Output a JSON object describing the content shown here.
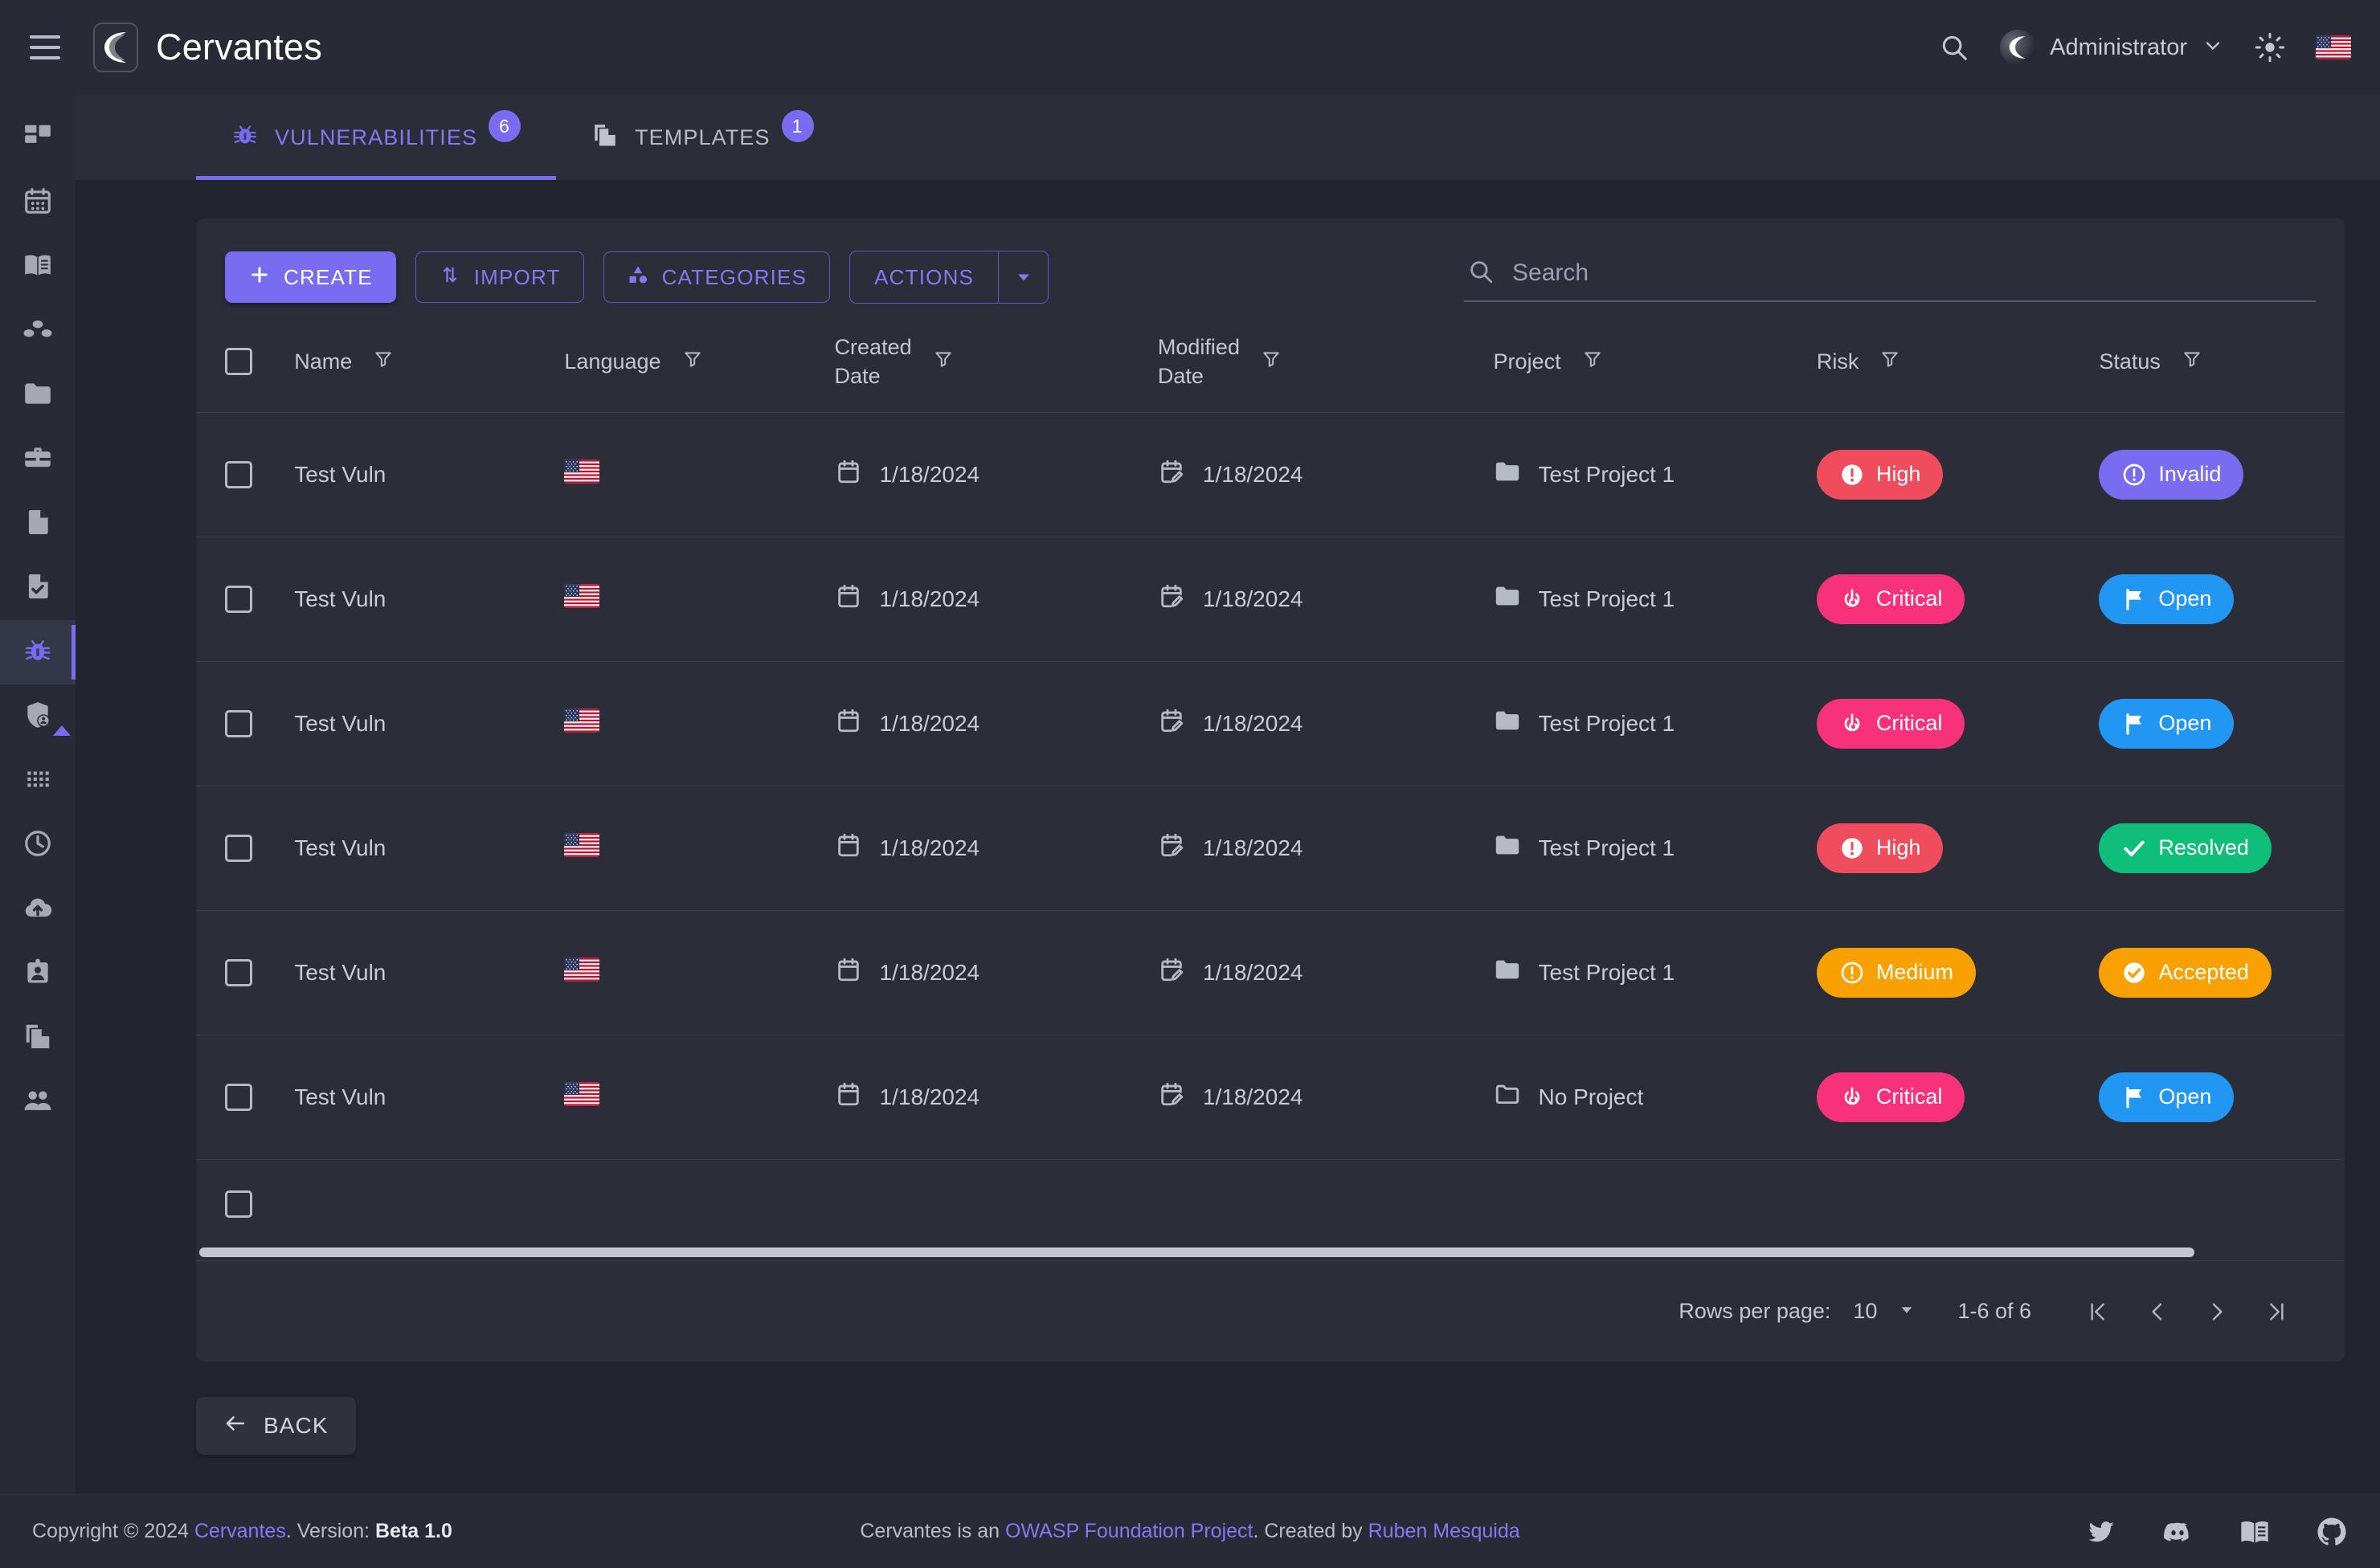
{
  "app": {
    "brand": "Cervantes",
    "menu_icon": "hamburger-icon",
    "logo_icon": "cervantes-logo-icon"
  },
  "header": {
    "search_icon": "search-icon",
    "user_name": "Administrator",
    "user_caret": "chevron-down-icon",
    "theme_icon": "sun-icon",
    "language_flag": "us-flag-icon"
  },
  "sidebar": {
    "items": [
      {
        "name": "dashboard",
        "icon": "dashboard-grid-icon",
        "active": false
      },
      {
        "name": "calendar",
        "icon": "calendar-icon",
        "active": false
      },
      {
        "name": "knowledge-base",
        "icon": "book-icon",
        "active": false
      },
      {
        "name": "organizations",
        "icon": "nodes-icon",
        "active": false
      },
      {
        "name": "projects",
        "icon": "folder-icon",
        "active": false
      },
      {
        "name": "clients",
        "icon": "briefcase-icon",
        "active": false
      },
      {
        "name": "reports",
        "icon": "file-icon",
        "active": false
      },
      {
        "name": "tasks",
        "icon": "file-check-icon",
        "active": false
      },
      {
        "name": "vulnerabilities",
        "icon": "bug-icon",
        "active": true
      },
      {
        "name": "security",
        "icon": "shield-user-icon",
        "active": false
      },
      {
        "name": "apps",
        "icon": "dots-grid-icon",
        "active": false
      },
      {
        "name": "history",
        "icon": "clock-icon",
        "active": false
      },
      {
        "name": "uploads",
        "icon": "cloud-upload-icon",
        "active": false
      },
      {
        "name": "profile",
        "icon": "id-card-icon",
        "active": false
      },
      {
        "name": "templates",
        "icon": "copy-file-icon",
        "active": false
      },
      {
        "name": "users",
        "icon": "users-icon",
        "active": false
      }
    ]
  },
  "tabs": [
    {
      "label": "VULNERABILITIES",
      "badge": "6",
      "icon": "bug-icon",
      "active": true
    },
    {
      "label": "TEMPLATES",
      "badge": "1",
      "icon": "copy-file-icon",
      "active": false
    }
  ],
  "toolbar": {
    "create_label": "CREATE",
    "create_icon": "plus-icon",
    "import_label": "IMPORT",
    "import_icon": "import-arrows-icon",
    "categories_label": "CATEGORIES",
    "categories_icon": "shapes-icon",
    "actions_label": "ACTIONS",
    "actions_caret_icon": "caret-down-icon"
  },
  "search": {
    "placeholder": "Search",
    "value": "",
    "icon": "search-icon"
  },
  "table": {
    "columns": [
      {
        "key": "check",
        "label": "",
        "filter": false
      },
      {
        "key": "name",
        "label": "Name",
        "filter": true
      },
      {
        "key": "lang",
        "label": "Language",
        "filter": true
      },
      {
        "key": "created",
        "label": "Created\nDate",
        "filter": true
      },
      {
        "key": "mod",
        "label": "Modified\nDate",
        "filter": true
      },
      {
        "key": "project",
        "label": "Project",
        "filter": true
      },
      {
        "key": "risk",
        "label": "Risk",
        "filter": true
      },
      {
        "key": "status",
        "label": "Status",
        "filter": true
      }
    ],
    "filter_icon": "filter-icon",
    "rows": [
      {
        "name": "Test Vuln",
        "language": "us-flag-icon",
        "created": "1/18/2024",
        "modified": "1/18/2024",
        "project": "Test Project 1",
        "project_icon": "folder-filled-icon",
        "risk": "High",
        "risk_icon": "exclamation-circle-icon",
        "risk_color": "#ef4c5e",
        "status": "Invalid",
        "status_icon": "exclamation-outline-icon",
        "status_color": "#7a6cf0"
      },
      {
        "name": "Test Vuln",
        "language": "us-flag-icon",
        "created": "1/18/2024",
        "modified": "1/18/2024",
        "project": "Test Project 1",
        "project_icon": "folder-filled-icon",
        "risk": "Critical",
        "risk_icon": "power-target-icon",
        "risk_color": "#f7317a",
        "status": "Open",
        "status_icon": "flag-icon",
        "status_color": "#2196f3"
      },
      {
        "name": "Test Vuln",
        "language": "us-flag-icon",
        "created": "1/18/2024",
        "modified": "1/18/2024",
        "project": "Test Project 1",
        "project_icon": "folder-filled-icon",
        "risk": "Critical",
        "risk_icon": "power-target-icon",
        "risk_color": "#f7317a",
        "status": "Open",
        "status_icon": "flag-icon",
        "status_color": "#2196f3"
      },
      {
        "name": "Test Vuln",
        "language": "us-flag-icon",
        "created": "1/18/2024",
        "modified": "1/18/2024",
        "project": "Test Project 1",
        "project_icon": "folder-filled-icon",
        "risk": "High",
        "risk_icon": "exclamation-circle-icon",
        "risk_color": "#ef4c5e",
        "status": "Resolved",
        "status_icon": "check-icon",
        "status_color": "#0fbf79"
      },
      {
        "name": "Test Vuln",
        "language": "us-flag-icon",
        "created": "1/18/2024",
        "modified": "1/18/2024",
        "project": "Test Project 1",
        "project_icon": "folder-filled-icon",
        "risk": "Medium",
        "risk_icon": "exclamation-outline-icon",
        "risk_color": "#f9a103",
        "status": "Accepted",
        "status_icon": "check-circle-icon",
        "status_color": "#f9a103"
      },
      {
        "name": "Test Vuln",
        "language": "us-flag-icon",
        "created": "1/18/2024",
        "modified": "1/18/2024",
        "project": "No Project",
        "project_icon": "folder-outline-icon",
        "risk": "Critical",
        "risk_icon": "power-target-icon",
        "risk_color": "#f7317a",
        "status": "Open",
        "status_icon": "flag-icon",
        "status_color": "#2196f3"
      }
    ],
    "created_icon": "calendar-icon",
    "modified_icon": "calendar-edit-icon"
  },
  "pagination": {
    "rows_per_page_label": "Rows per page:",
    "rows_per_page_value": "10",
    "range_label": "1-6 of 6",
    "first_icon": "first-page-icon",
    "prev_icon": "prev-page-icon",
    "next_icon": "next-page-icon",
    "last_icon": "last-page-icon"
  },
  "back": {
    "label": "BACK",
    "icon": "arrow-left-icon"
  },
  "footer": {
    "copyright_prefix": "Copyright © 2024 ",
    "brand_link": "Cervantes",
    "version_label": ". Version: ",
    "version_value": "Beta 1.0",
    "center_prefix": "Cervantes is an ",
    "center_link1": "OWASP Foundation Project",
    "center_mid": ". Created by ",
    "center_link2": "Ruben Mesquida",
    "socials": [
      {
        "name": "twitter-icon"
      },
      {
        "name": "discord-icon"
      },
      {
        "name": "book-icon"
      },
      {
        "name": "github-icon"
      }
    ]
  },
  "colors": {
    "accent": "#7a6cf0",
    "surface": "#2b2d38",
    "bg": "#22242e",
    "topbar": "#282a36"
  }
}
